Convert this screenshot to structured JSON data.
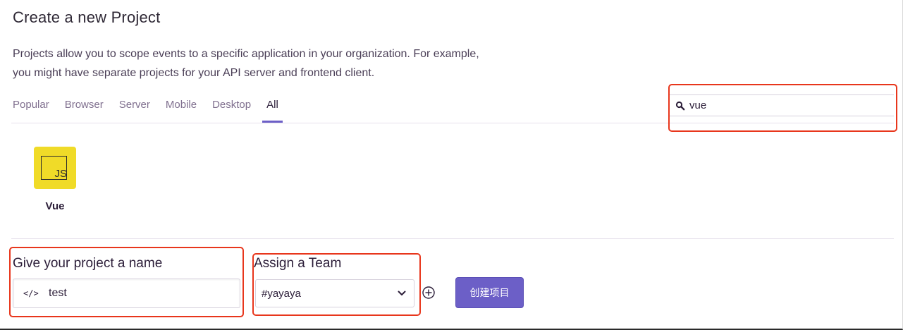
{
  "header": {
    "title": "Create a new Project",
    "description_line1": "Projects allow you to scope events to a specific application in your organization. For example,",
    "description_line2": "you might have separate projects for your API server and frontend client."
  },
  "tabs": [
    {
      "label": "Popular",
      "active": false
    },
    {
      "label": "Browser",
      "active": false
    },
    {
      "label": "Server",
      "active": false
    },
    {
      "label": "Mobile",
      "active": false
    },
    {
      "label": "Desktop",
      "active": false
    },
    {
      "label": "All",
      "active": true
    }
  ],
  "search": {
    "value": "vue",
    "icon": "search-icon"
  },
  "platforms": [
    {
      "name": "Vue",
      "logo_text": "JS",
      "logo_color": "#f0db28"
    }
  ],
  "project_name": {
    "label": "Give your project a name",
    "icon": "code-icon",
    "icon_text": "</>",
    "value": "test"
  },
  "team": {
    "label": "Assign a Team",
    "selected": "#yayaya"
  },
  "create_button": {
    "label": "创建项目"
  },
  "colors": {
    "accent": "#6c5fc7",
    "highlight_box": "#e8361c",
    "js_yellow": "#f0db28"
  }
}
